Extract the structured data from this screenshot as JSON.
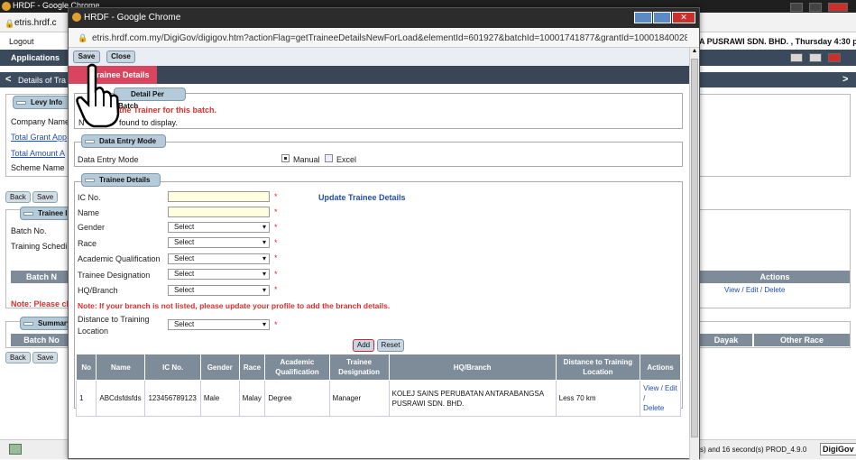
{
  "background": {
    "window_title": "HRDF - Google Chrome",
    "url": "etris.hrdf.c",
    "logout": "Logout",
    "welcome": "A PUSRAWI SDN. BHD. , Thursday 4:30 pm",
    "app_label": "Applications",
    "crumb": "Details of Tra",
    "levy_info": "Levy Info",
    "company_name": "Company Name",
    "total_grant": "Total Grant App",
    "total_amount": "Total Amount A",
    "scheme_name": "Scheme Name",
    "back": "Back",
    "save": "Save",
    "trainee_legend": "Trainee I",
    "batch_no": "Batch No.",
    "training_schedule": "Training Schedi",
    "batch_col": "Batch N",
    "actions_col": "Actions",
    "actions_links": {
      "view": "View",
      "edit": "Edit",
      "delete": "Delete"
    },
    "note": "Note: Please cli",
    "summary_legend": "Summary",
    "batch_col2": "Batch No",
    "dayak": "Dayak",
    "other_race": "Other Race",
    "status_bar": "s) and 16 second(s)  PROD_4.9.0",
    "logo": "DigiGov"
  },
  "popup": {
    "window_title": "HRDF - Google Chrome",
    "url": "etris.hrdf.com.my/DigiGov/digigov.htm?actionFlag=getTraineeDetailsNewForLoad&elementId=601927&batchId=10001741877&grantId=10001840028...",
    "toolbar": {
      "save": "Save",
      "close": "Close"
    },
    "tab": "Trainee Details",
    "trainer_section": {
      "legend": "Detail Per Batch",
      "error": "the Trainer for this batch.",
      "no_records_prefix": "N",
      "no_records": "found to display."
    },
    "data_entry": {
      "legend": "Data Entry Mode",
      "label": "Data Entry Mode",
      "option_manual": "Manual",
      "option_excel": "Excel",
      "selected": "Manual"
    },
    "trainee": {
      "legend": "Trainee Details",
      "update_link": "Update Trainee Details",
      "fields": {
        "ic_label": "IC No.",
        "name_label": "Name",
        "gender_label": "Gender",
        "race_label": "Race",
        "academic_label": "Academic Qualification",
        "designation_label": "Trainee Designation",
        "hq_label": "HQ/Branch",
        "distance_label_1": "Distance to Training",
        "distance_label_2": "Location",
        "select": "Select",
        "star": "*"
      },
      "branch_note": "Note: If your branch is not listed, please update your profile to add the branch details.",
      "add": "Add",
      "reset": "Reset",
      "table": {
        "headers": [
          "No",
          "Name",
          "IC No.",
          "Gender",
          "Race",
          "Academic Qualification",
          "Trainee Designation",
          "HQ/Branch",
          "Distance to Training Location",
          "Actions"
        ],
        "rows": [
          {
            "no": "1",
            "name": "ABCdsfdsfds",
            "ic": "123456789123",
            "gender": "Male",
            "race": "Malay",
            "academic": "Degree",
            "designation": "Manager",
            "branch": "KOLEJ SAINS PERUBATAN ANTARABANGSA PUSRAWI SDN. BHD.",
            "distance": "Less 70 km",
            "view": "View",
            "edit": "Edit",
            "delete": "Delete"
          }
        ]
      }
    }
  },
  "colors": {
    "tab_active": "#d9455e",
    "header": "#7e8c99",
    "legend": "#b5cbd9",
    "error": "#d9302c",
    "link": "#1f4fae"
  }
}
